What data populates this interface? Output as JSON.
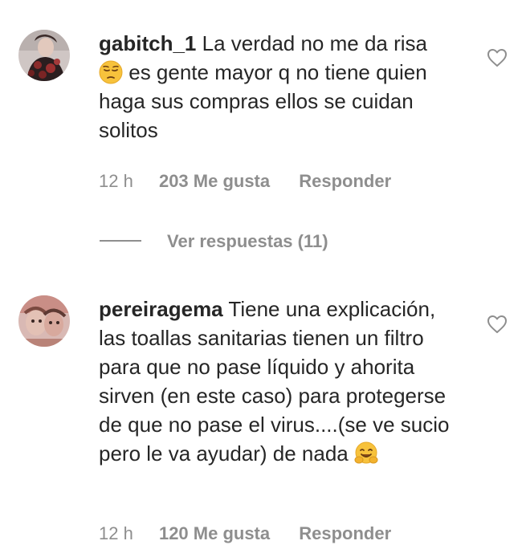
{
  "comments": [
    {
      "username": "gabitch_1",
      "text_part1": "La verdad no me da risa",
      "emoji_1": "pensive-face-emoji",
      "text_part2": "es gente mayor q no tiene quien haga sus compras ellos se cuidan solitos",
      "time": "12 h",
      "likes": "203 Me gusta",
      "reply": "Responder",
      "view_replies": "Ver respuestas (11)"
    },
    {
      "username": "pereiragema",
      "text_part1": "Tiene una explicación, las toallas sanitarias tienen un filtro para que no pase líquido y ahorita sirven (en este caso) para protegerse de que no pase el virus....(se ve sucio pero le va ayudar) de nada",
      "emoji_1": "hugging-face-emoji",
      "time": "12 h",
      "likes": "120 Me gusta",
      "reply": "Responder"
    }
  ],
  "colors": {
    "primary_text": "#262626",
    "secondary_text": "#8e8e8e",
    "background": "#ffffff"
  }
}
